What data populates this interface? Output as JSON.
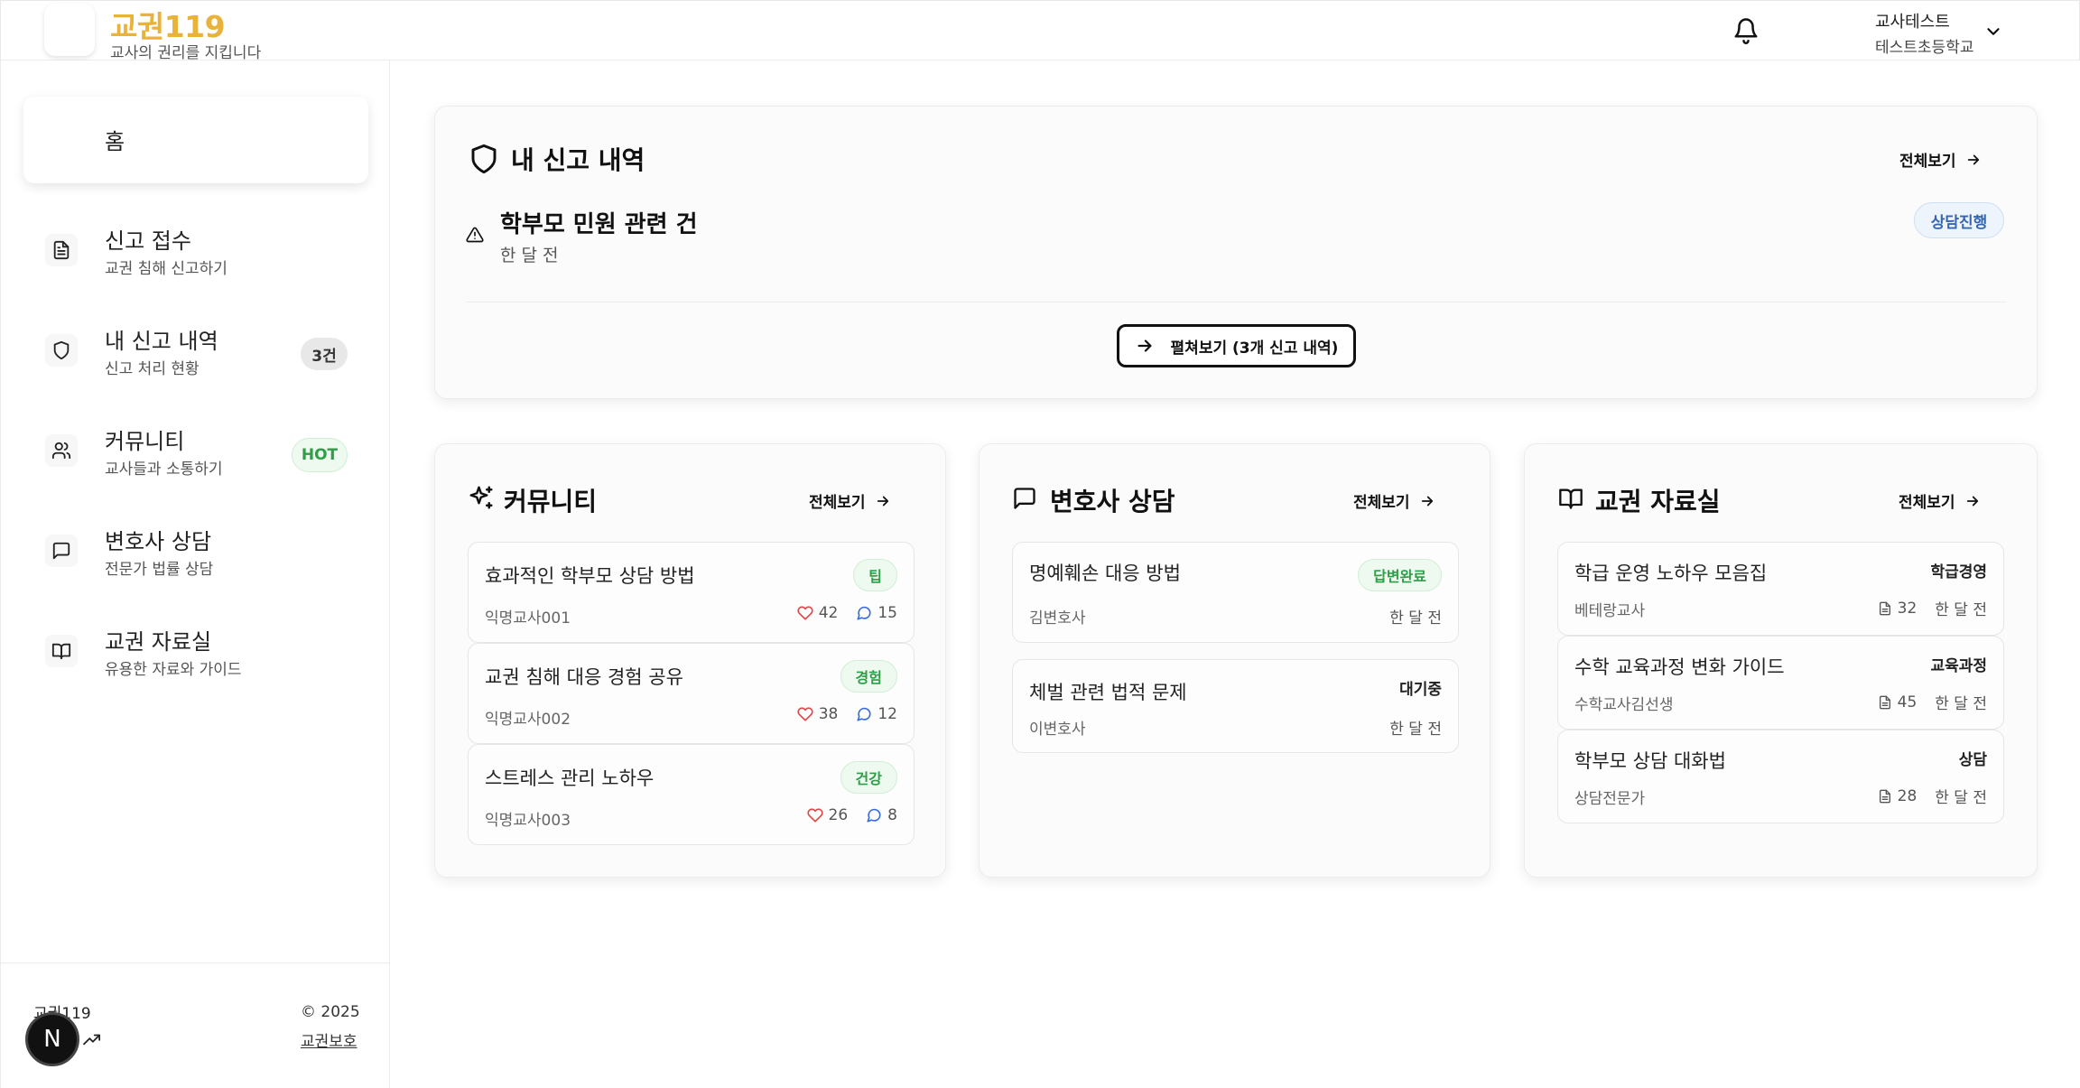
{
  "header": {
    "brand": "교권119",
    "brand_sub": "교사의 권리를 지킵니다",
    "user_name": "교사테스트",
    "user_school": "테스트초등학교"
  },
  "sidebar": {
    "home_label": "홈",
    "items": [
      {
        "title": "신고 접수",
        "sub": "교권 침해 신고하기",
        "icon": "document-icon"
      },
      {
        "title": "내 신고 내역",
        "sub": "신고 처리 현황",
        "badge": "3건",
        "icon": "shield-icon"
      },
      {
        "title": "커뮤니티",
        "sub": "교사들과 소통하기",
        "badge": "HOT",
        "icon": "users-icon"
      },
      {
        "title": "변호사 상담",
        "sub": "전문가 법률 상담",
        "icon": "message-icon"
      },
      {
        "title": "교권 자료실",
        "sub": "유용한 자료와 가이드",
        "icon": "book-icon"
      }
    ],
    "footer_brand": "교권119",
    "footer_copy": "© 2025",
    "footer_guard": "교권보호",
    "n_badge": "N"
  },
  "reports": {
    "title": "내 신고 내역",
    "see_all": "전체보기",
    "item_title": "학부모 민원 관련 건",
    "item_time": "한 달 전",
    "status": "상담진행",
    "expand_label": "펼쳐보기 (3개 신고 내역)"
  },
  "community": {
    "title": "커뮤니티",
    "see_all": "전체보기",
    "posts": [
      {
        "title": "효과적인 학부모 상담 방법",
        "author": "익명교사001",
        "tag": "팁",
        "likes": "42",
        "comments": "15"
      },
      {
        "title": "교권 침해 대응 경험 공유",
        "author": "익명교사002",
        "tag": "경험",
        "likes": "38",
        "comments": "12"
      },
      {
        "title": "스트레스 관리 노하우",
        "author": "익명교사003",
        "tag": "건강",
        "likes": "26",
        "comments": "8"
      }
    ]
  },
  "lawyer": {
    "title": "변호사 상담",
    "see_all": "전체보기",
    "items": [
      {
        "title": "명예훼손 대응 방법",
        "lawyer": "김변호사",
        "status": "답변완료",
        "time": "한 달 전"
      },
      {
        "title": "체벌 관련 법적 문제",
        "lawyer": "이변호사",
        "status": "대기중",
        "time": "한 달 전"
      }
    ]
  },
  "resources": {
    "title": "교권 자료실",
    "see_all": "전체보기",
    "items": [
      {
        "title": "학급 운영 노하우 모음집",
        "author": "베테랑교사",
        "category": "학급경영",
        "downloads": "32",
        "time": "한 달 전"
      },
      {
        "title": "수학 교육과정 변화 가이드",
        "author": "수학교사김선생",
        "category": "교육과정",
        "downloads": "45",
        "time": "한 달 전"
      },
      {
        "title": "학부모 상담 대화법",
        "author": "상담전문가",
        "category": "상담",
        "downloads": "28",
        "time": "한 달 전"
      }
    ]
  },
  "colors": {
    "brand": "#e9b23a",
    "green": "#2e9e48",
    "blue": "#3766b0",
    "heart": "#e04848",
    "comment": "#3b6fd6"
  }
}
